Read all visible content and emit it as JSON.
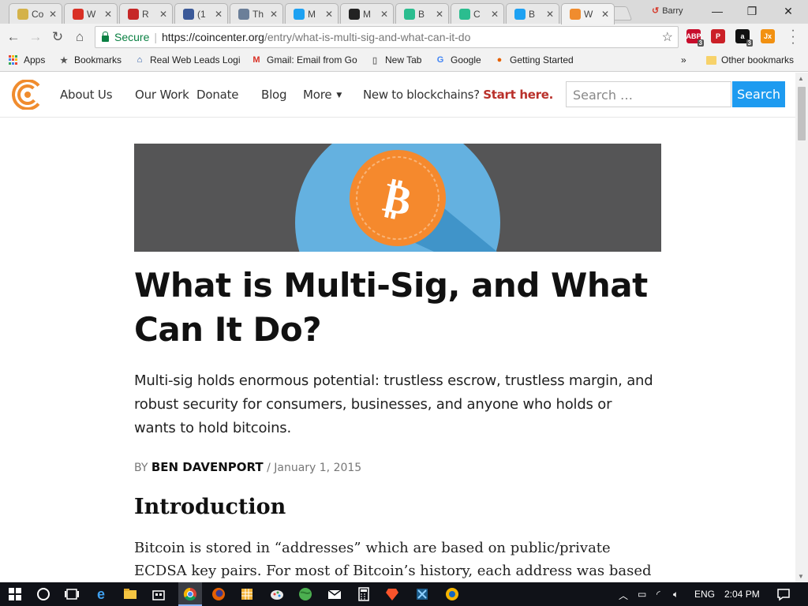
{
  "browser": {
    "tabs": [
      {
        "title": "Co",
        "favicon": "coincenter-globe-icon",
        "color": "#d4b24a"
      },
      {
        "title": "W",
        "favicon": "gmail-icon",
        "color": "#d93025"
      },
      {
        "title": "R",
        "favicon": "r-icon",
        "color": "#c62828"
      },
      {
        "title": "(1",
        "favicon": "facebook-icon",
        "color": "#3b5998"
      },
      {
        "title": "Th",
        "favicon": "bitcoin-b-icon",
        "color": "#6b7f99"
      },
      {
        "title": "M",
        "favicon": "twitter-icon",
        "color": "#1da1f2"
      },
      {
        "title": "M",
        "favicon": "github-icon",
        "color": "#222222"
      },
      {
        "title": "B",
        "favicon": "green-circle-icon",
        "color": "#2bbd8f"
      },
      {
        "title": "C",
        "favicon": "green-circle-icon",
        "color": "#2bbd8f"
      },
      {
        "title": "B",
        "favicon": "twitter-icon",
        "color": "#1da1f2"
      },
      {
        "title": "W",
        "favicon": "coincenter-icon",
        "color": "#f08c2e",
        "active": true
      }
    ],
    "profile_name": "Barry",
    "window_controls": {
      "minimize": "—",
      "maximize": "❐",
      "close": "✕"
    },
    "secure_label": "Secure",
    "url_base": "https://coincenter.org",
    "url_path": "/entry/what-is-multi-sig-and-what-can-it-do",
    "extensions": [
      {
        "name": "adblock-icon",
        "label": "ABP",
        "badge": "3",
        "color": "#c70d2c"
      },
      {
        "name": "pinterest-icon",
        "label": "P",
        "color": "#cb2027"
      },
      {
        "name": "amazon-icon",
        "label": "a",
        "badge": "3",
        "color": "#111111"
      },
      {
        "name": "jx-icon",
        "label": "Jx",
        "color": "#f29111"
      }
    ],
    "bookmarks": [
      {
        "label": "Apps",
        "icon": "apps-grid-icon"
      },
      {
        "label": "Bookmarks",
        "icon": "star-icon"
      },
      {
        "label": "Real Web Leads Logi",
        "icon": "house-icon"
      },
      {
        "label": "Gmail: Email from Go",
        "icon": "gmail-icon"
      },
      {
        "label": "New Tab",
        "icon": "page-icon"
      },
      {
        "label": "Google",
        "icon": "google-icon"
      },
      {
        "label": "Getting Started",
        "icon": "firefox-icon"
      }
    ],
    "bookmarks_overflow": "»",
    "other_bookmarks": "Other bookmarks"
  },
  "site": {
    "nav": [
      {
        "label": "About Us"
      },
      {
        "label": "Our Work"
      },
      {
        "label": "Donate"
      },
      {
        "label": "Blog"
      },
      {
        "label": "More"
      }
    ],
    "new_to_prefix": "New to blockchains?",
    "new_to_link": "Start here.",
    "search_placeholder": "Search …",
    "search_button": "Search"
  },
  "article": {
    "title": "What is Multi-Sig, and What Can It Do?",
    "dek": "Multi-sig holds enormous potential: trustless escrow, trustless margin, and robust security for consumers, businesses, and anyone who holds or wants to hold bitcoins.",
    "by_label": "BY",
    "author": "BEN DAVENPORT",
    "date_sep": "/",
    "date": "January 1, 2015",
    "section_heading": "Introduction",
    "body": "Bitcoin is stored in “addresses” which are based on public/private ECDSA key pairs. For most of Bitcoin’s history, each address was based on a single"
  },
  "taskbar": {
    "language": "ENG",
    "time": "2:04 PM",
    "colors": {
      "accent": "#f08c2e",
      "link": "#b9302a",
      "search_button": "#1e9bf0"
    }
  }
}
